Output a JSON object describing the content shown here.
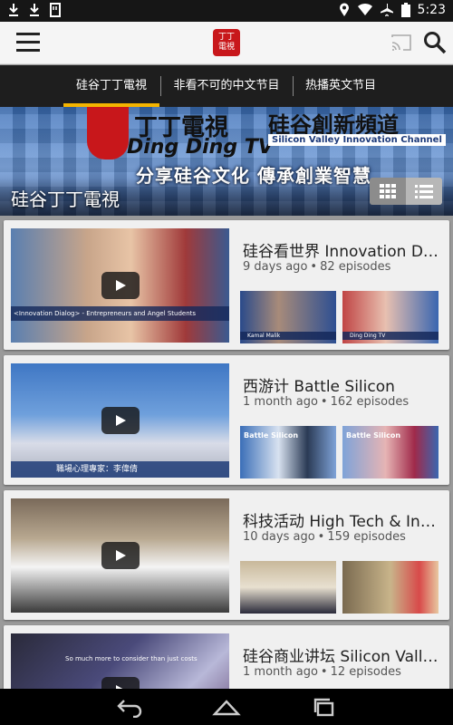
{
  "status_bar": {
    "time": "5:23",
    "left_icons": [
      "download-icon",
      "download-icon",
      "sd-card-icon"
    ],
    "right_icons": [
      "location-icon",
      "wifi-icon",
      "airplane-icon",
      "battery-icon"
    ]
  },
  "app_bar": {
    "logo_text_line1": "丁丁",
    "logo_text_line2": "電視"
  },
  "tabs": [
    {
      "label": "硅谷丁丁電視",
      "active": true
    },
    {
      "label": "非看不可的中文节目",
      "active": false
    },
    {
      "label": "热播英文节目",
      "active": false
    }
  ],
  "banner": {
    "brand_cn": "丁丁電視",
    "brand_en": "Ding Ding TV",
    "channel_cn": "硅谷創新頻道",
    "channel_en": "Silicon Valley Innovation Channel",
    "slogan": "分享硅谷文化 傳承創業智慧",
    "channel_title": "硅谷丁丁電視"
  },
  "colors": {
    "tab_indicator": "#f4b400",
    "brand_red": "#c8171b",
    "tab_bar": "#1e1e1e"
  },
  "playlists": [
    {
      "title": "硅谷看世界   Innovation Dialog",
      "age": "9 days ago",
      "episodes": "82 episodes",
      "thumb_caption": "<Innovation Dialog> - Entrepreneurs and Angel Students",
      "mini_a_caption": "Kamal Malik",
      "mini_b_caption": "Ding Ding TV"
    },
    {
      "title": "西游计   Battle Silicon",
      "age": "1 month ago",
      "episodes": "162 episodes",
      "thumb_caption": "職場心理專家：李偉倩",
      "mini_a_caption": "Battle Silicon",
      "mini_b_caption": "Battle Silicon"
    },
    {
      "title": "科技活动   High Tech & Innovation",
      "age": "10 days ago",
      "episodes": "159 episodes",
      "thumb_caption": "",
      "mini_a_caption": "",
      "mini_b_caption": ""
    },
    {
      "title": "硅谷商业讲坛   Silicon Valley Business",
      "age": "1 month ago",
      "episodes": "12 episodes",
      "thumb_caption": "So much more to consider than just costs",
      "mini_a_caption": "",
      "mini_b_caption": ""
    }
  ]
}
